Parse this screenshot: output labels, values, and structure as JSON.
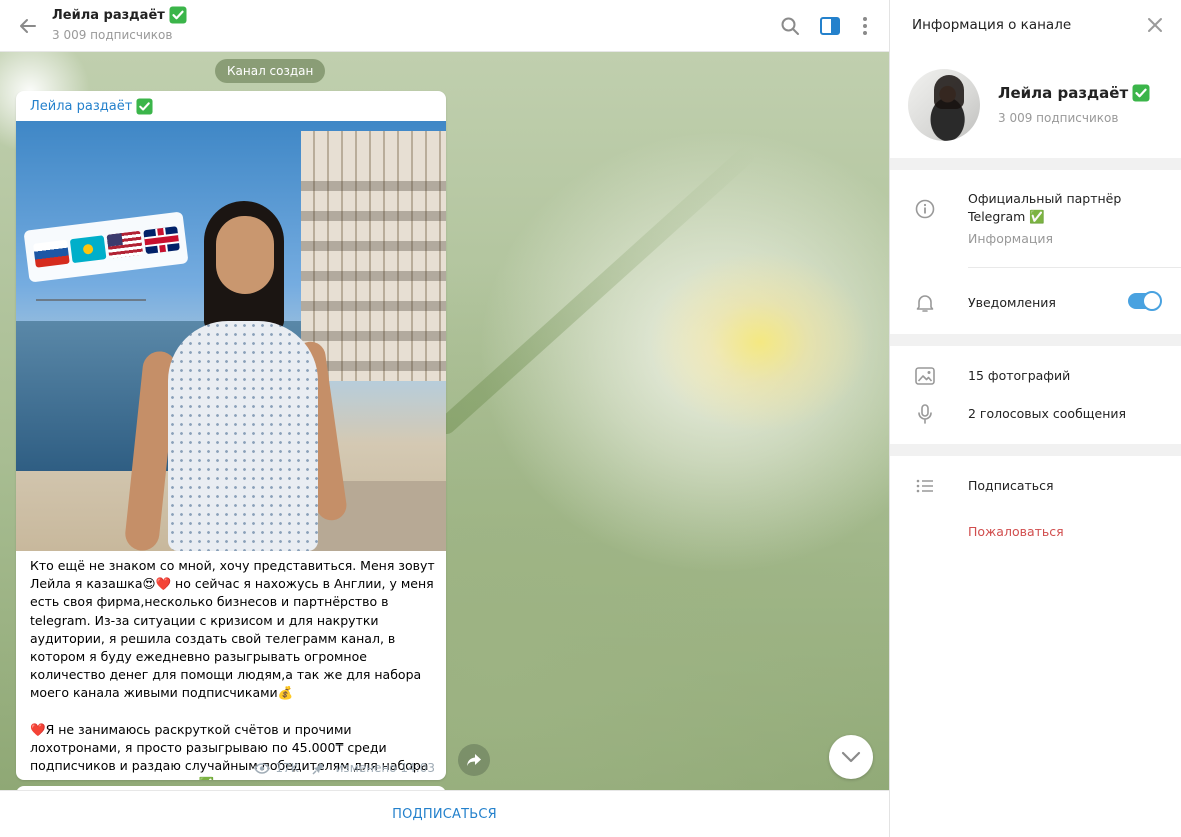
{
  "chat": {
    "title": "Лейла раздаёт",
    "subscribers": "3 009 подписчиков",
    "service_message": "Канал создан",
    "post": {
      "author": "Лейла раздаёт",
      "text": "Кто ещё не знаком со мной, хочу представиться. Меня зовут Лейла я казашка😍❤️ но  сейчас я нахожусь в Англии, у меня есть своя фирма,несколько бизнесов и партнёрство в telegram. Из-за ситуации с кризисом и для накрутки аудитории, я решила создать свой телеграмм канал, в котором я буду ежедневно разыгрывать огромное количество денег для помощи людям,а так же для набора  моего канала живыми подписчиками💰\n\n❤️Я не занимаюсь раскруткой счётов и прочими лохотронами, я просто разыгрываю по 45.000₸ среди подписчиков и раздаю случайным победителям для набора аудитории моего канала ✅",
      "views": "17K",
      "edited": "изменено 14:03"
    },
    "join_label": "ПОДПИСАТЬСЯ"
  },
  "info": {
    "header_title": "Информация о канале",
    "name": "Лейла раздаёт",
    "subscribers": "3 009 подписчиков",
    "description": "Официальный партнёр Telegram ✅",
    "description_label": "Информация",
    "notifications_label": "Уведомления",
    "notifications_on": true,
    "photos_label": "15 фотографий",
    "voice_label": "2 голосовых сообщения",
    "subscribe_label": "Подписаться",
    "report_label": "Пожаловаться"
  },
  "colors": {
    "accent": "#2481cc",
    "toggle": "#49a2e0",
    "verified": "#3bb54a",
    "danger": "#d14e4e"
  },
  "icons": [
    "back-arrow-icon",
    "search-icon",
    "sidebar-toggle-icon",
    "more-vertical-icon",
    "verified-check-icon",
    "eye-icon",
    "pin-icon",
    "share-icon",
    "chevron-down-icon",
    "close-icon",
    "info-icon",
    "bell-icon",
    "photo-icon",
    "microphone-icon",
    "list-icon"
  ]
}
